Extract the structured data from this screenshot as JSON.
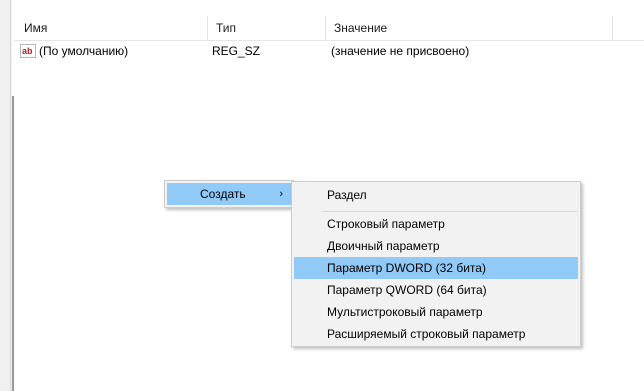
{
  "listview": {
    "columns": [
      "Имя",
      "Тип",
      "Значение"
    ],
    "rows": [
      {
        "icon": "string-value-icon",
        "icon_text": "ab",
        "name": "(По умолчанию)",
        "type": "REG_SZ",
        "value": "(значение не присвоено)"
      }
    ]
  },
  "context_menu": {
    "item": "Создать",
    "arrow": "›"
  },
  "submenu": {
    "items": [
      "Раздел",
      "Строковый параметр",
      "Двоичный параметр",
      "Параметр DWORD (32 бита)",
      "Параметр QWORD (64 бита)",
      "Мультистроковый параметр",
      "Расширяемый строковый параметр"
    ],
    "highlighted_index": 3
  },
  "colors": {
    "highlight": "#91c9f7",
    "menu_bg": "#f2f2f2",
    "icon_text": "#c41e1e"
  }
}
